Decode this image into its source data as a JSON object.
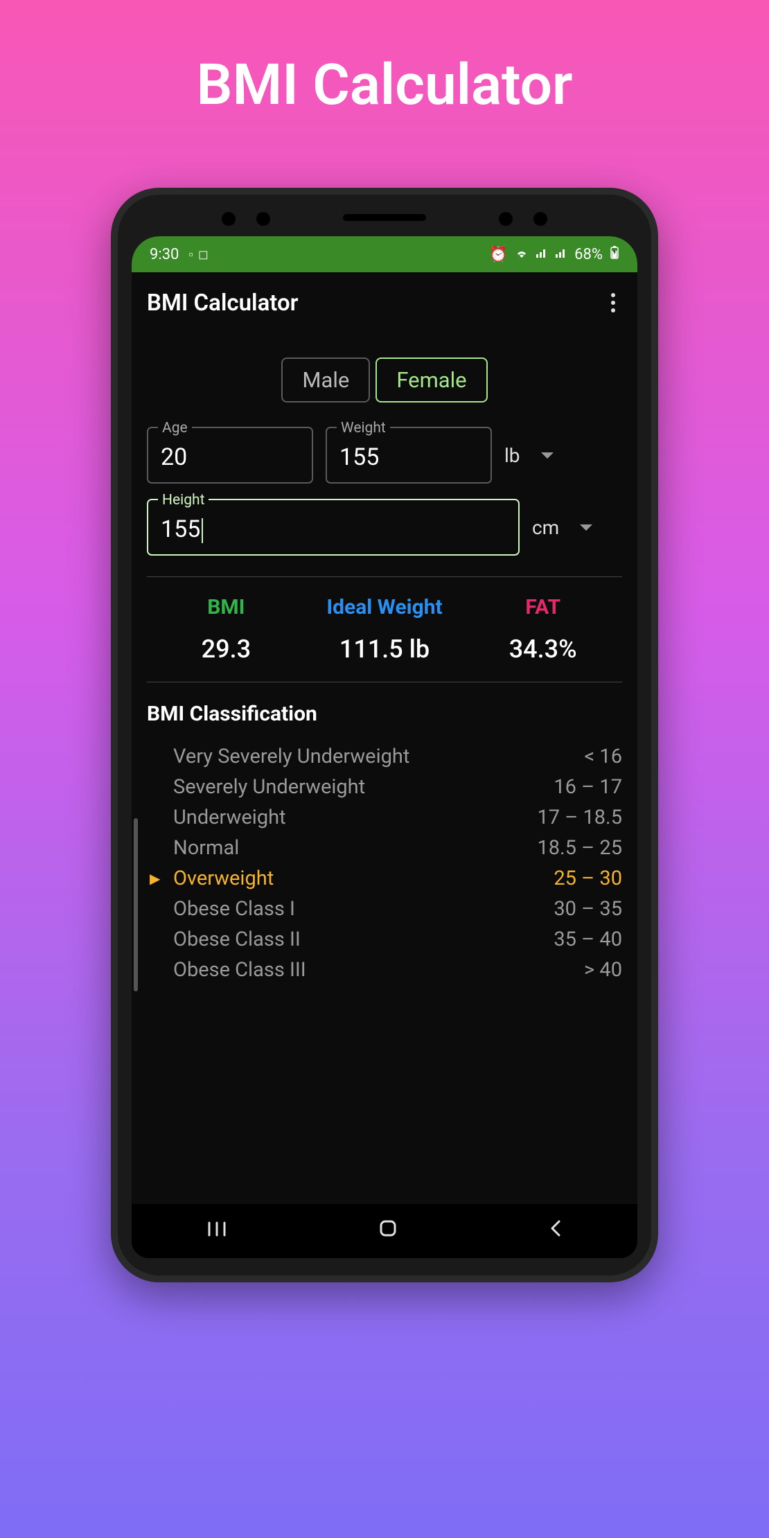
{
  "page_title": "BMI Calculator",
  "status": {
    "time": "9:30",
    "battery": "68%"
  },
  "app_bar": {
    "title": "BMI Calculator"
  },
  "gender": {
    "male": "Male",
    "female": "Female",
    "selected": "Female"
  },
  "inputs": {
    "age_label": "Age",
    "age_value": "20",
    "weight_label": "Weight",
    "weight_value": "155",
    "weight_unit": "lb",
    "height_label": "Height",
    "height_value": "155",
    "height_unit": "cm"
  },
  "results": {
    "bmi_label": "BMI",
    "bmi_value": "29.3",
    "ideal_label": "Ideal Weight",
    "ideal_value": "111.5 lb",
    "fat_label": "FAT",
    "fat_value": "34.3%"
  },
  "classification": {
    "title": "BMI Classification",
    "active_index": 4,
    "rows": [
      {
        "label": "Very Severely Underweight",
        "range": "< 16"
      },
      {
        "label": "Severely Underweight",
        "range": "16 – 17"
      },
      {
        "label": "Underweight",
        "range": "17 – 18.5"
      },
      {
        "label": "Normal",
        "range": "18.5 – 25"
      },
      {
        "label": "Overweight",
        "range": "25 – 30"
      },
      {
        "label": "Obese Class I",
        "range": "30 – 35"
      },
      {
        "label": "Obese Class II",
        "range": "35 – 40"
      },
      {
        "label": "Obese Class III",
        "range": "> 40"
      }
    ]
  }
}
